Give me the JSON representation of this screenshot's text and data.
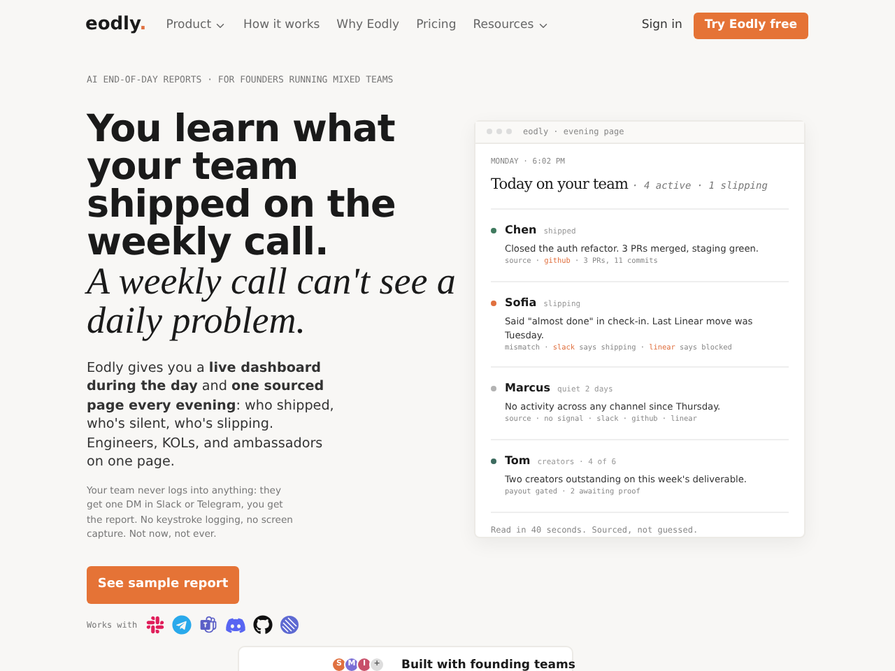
{
  "brand": {
    "name": "eodly",
    "mark": "."
  },
  "nav": [
    {
      "label": "Product",
      "dropdown": true
    },
    {
      "label": "How it works",
      "dropdown": false
    },
    {
      "label": "Why Eodly",
      "dropdown": false
    },
    {
      "label": "Pricing",
      "dropdown": false
    },
    {
      "label": "Resources",
      "dropdown": true
    }
  ],
  "sign_in": "Sign in",
  "cta": "Try Eodly free",
  "eyebrow": "AI END-OF-DAY REPORTS · FOR FOUNDERS RUNNING MIXED TEAMS",
  "headline": "You learn what your team shipped on the weekly call.",
  "headline_serif": "A weekly call can't see a daily problem.",
  "lead": "Eodly gives you a **live dashboard during the day** and **one sourced page every evening**: who shipped, who's silent, who's slipping. Engineers, KOLs, and ambassadors on one page.",
  "note": "Your team never logs into anything: they get one DM in Slack or Telegram, you get the report. No keystroke logging, no screen capture. Not now, not ever.",
  "primary_button": "See sample report",
  "works_with": {
    "label": "Works with",
    "apps": [
      {
        "kind": "slack"
      },
      {
        "kind": "telegram"
      },
      {
        "kind": "teams"
      },
      {
        "kind": "discord"
      },
      {
        "kind": "github"
      },
      {
        "kind": "linear"
      }
    ]
  },
  "report": {
    "window_title": "eodly · evening page",
    "date": "MONDAY · 6:02 PM",
    "title": "Today on your team",
    "summary": "· 4 active · 1 slipping",
    "people": [
      {
        "name": "Chen",
        "status": "shipped",
        "color": "#3f7a5e",
        "text": "Closed the auth refactor. 3 PRs merged, staging green.",
        "meta": [
          {
            "text": "source · ",
            "highlight": false
          },
          {
            "text": "github",
            "highlight": true
          },
          {
            "text": " · 3 PRs, 11 commits",
            "highlight": false
          }
        ]
      },
      {
        "name": "Sofia",
        "status": "slipping",
        "color": "#e0703f",
        "text": "Said \"almost done\" in check-in. Last Linear move was Tuesday.",
        "meta": [
          {
            "text": "mismatch · ",
            "highlight": false
          },
          {
            "text": "slack",
            "highlight": true
          },
          {
            "text": " says shipping · ",
            "highlight": false
          },
          {
            "text": "linear",
            "highlight": true
          },
          {
            "text": " says blocked",
            "highlight": false
          }
        ]
      },
      {
        "name": "Marcus",
        "status": "quiet 2 days",
        "color": "#b3b3b3",
        "text": "No activity across any channel since Thursday.",
        "meta": [
          {
            "text": "source · no signal · slack · github · linear",
            "highlight": false
          }
        ]
      },
      {
        "name": "Tom",
        "status": "creators · 4 of 6",
        "color": "#3d6b5f",
        "text": "Two creators outstanding on this week's deliverable.",
        "meta": [
          {
            "text": "payout gated · 2 awaiting proof",
            "highlight": false
          }
        ]
      }
    ],
    "footer": "Read in 40 seconds. Sourced, not guessed."
  },
  "founders": {
    "avatars": [
      {
        "letter": "S",
        "color": "#e0703f"
      },
      {
        "letter": "M",
        "color": "#7b6fd6"
      },
      {
        "letter": "I",
        "color": "#c8506a"
      },
      {
        "letter": "+",
        "color": "#dddddd"
      }
    ],
    "label": "Built with founding teams"
  }
}
